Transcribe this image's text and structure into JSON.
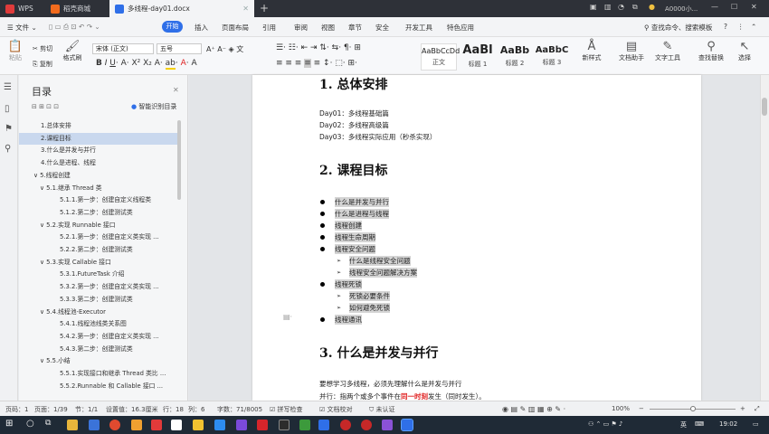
{
  "titlebar": {
    "tabs": [
      {
        "label": "WPS",
        "active": false
      },
      {
        "label": "稻壳商城",
        "active": false
      },
      {
        "label": "多线程-day01.docx",
        "active": true
      }
    ],
    "user": "A0000小..."
  },
  "menubar": {
    "file_label": "文件",
    "start_label": "开始",
    "items": [
      "插入",
      "页面布局",
      "引用",
      "审阅",
      "视图",
      "章节",
      "安全",
      "开发工具",
      "特色应用"
    ],
    "search_label": "查找命令、搜索模板"
  },
  "ribbon": {
    "cut": "剪切",
    "copy": "复制",
    "paste": "粘贴",
    "format_painter": "格式刷",
    "font_name": "宋体 (正文)",
    "font_size": "五号",
    "styles": [
      {
        "preview": "AaBbCcDd",
        "label": "正文"
      },
      {
        "preview": "AaBl",
        "label": "标题 1"
      },
      {
        "preview": "AaBb",
        "label": "标题 2"
      },
      {
        "preview": "AaBbC",
        "label": "标题 3"
      }
    ],
    "new_style": "新样式",
    "doc_helper": "文档助手",
    "text_tools": "文字工具",
    "find_replace": "查找替换",
    "select": "选择"
  },
  "toc": {
    "title": "目录",
    "smart": "智能识别目录",
    "items": [
      {
        "label": "1.总体安排",
        "indent": 0,
        "selected": false,
        "arrow": ""
      },
      {
        "label": "2.课程目标",
        "indent": 0,
        "selected": true,
        "arrow": ""
      },
      {
        "label": "3.什么是并发与并行",
        "indent": 0,
        "selected": false,
        "arrow": ""
      },
      {
        "label": "4.什么是进程、线程",
        "indent": 0,
        "selected": false,
        "arrow": ""
      },
      {
        "label": "5.线程创建",
        "indent": 0,
        "selected": false,
        "arrow": "∨"
      },
      {
        "label": "5.1.继承 Thread 类",
        "indent": 1,
        "selected": false,
        "arrow": "∨"
      },
      {
        "label": "5.1.1.第一步：创建自定义线程类",
        "indent": 2,
        "selected": false,
        "arrow": ""
      },
      {
        "label": "5.1.2.第二步：创建测试类",
        "indent": 2,
        "selected": false,
        "arrow": ""
      },
      {
        "label": "5.2.实现 Runnable 接口",
        "indent": 1,
        "selected": false,
        "arrow": "∨"
      },
      {
        "label": "5.2.1.第一步：创建自定义类实现 ...",
        "indent": 2,
        "selected": false,
        "arrow": ""
      },
      {
        "label": "5.2.2.第二步：创建测试类",
        "indent": 2,
        "selected": false,
        "arrow": ""
      },
      {
        "label": "5.3.实现 Callable 接口",
        "indent": 1,
        "selected": false,
        "arrow": "∨"
      },
      {
        "label": "5.3.1.FutureTask 介绍",
        "indent": 2,
        "selected": false,
        "arrow": ""
      },
      {
        "label": "5.3.2.第一步：创建自定义类实现 ...",
        "indent": 2,
        "selected": false,
        "arrow": ""
      },
      {
        "label": "5.3.3.第二步：创建测试类",
        "indent": 2,
        "selected": false,
        "arrow": ""
      },
      {
        "label": "5.4.线程池-Executor",
        "indent": 1,
        "selected": false,
        "arrow": "∨"
      },
      {
        "label": "5.4.1.线程池线类关系图",
        "indent": 2,
        "selected": false,
        "arrow": ""
      },
      {
        "label": "5.4.2.第一步：创建自定义类实现 ...",
        "indent": 2,
        "selected": false,
        "arrow": ""
      },
      {
        "label": "5.4.3.第二步：创建测试类",
        "indent": 2,
        "selected": false,
        "arrow": ""
      },
      {
        "label": "5.5.小结",
        "indent": 1,
        "selected": false,
        "arrow": "∨"
      },
      {
        "label": "5.5.1.实现接口和继承 Thread 类比 ...",
        "indent": 2,
        "selected": false,
        "arrow": ""
      },
      {
        "label": "5.5.2.Runnable 和 Callable 接口 ...",
        "indent": 2,
        "selected": false,
        "arrow": ""
      }
    ]
  },
  "doc": {
    "h1": "1. 总体安排",
    "days": [
      "Day01：多线程基础篇",
      "Day02：多线程高级篇",
      "Day03：多线程实际应用（秒杀实现）"
    ],
    "h2": "2. 课程目标",
    "bullets": [
      {
        "text": "什么是并发与并行",
        "level": 0
      },
      {
        "text": "什么是进程与线程",
        "level": 0
      },
      {
        "text": "线程创建",
        "level": 0
      },
      {
        "text": "线程生命周期",
        "level": 0
      },
      {
        "text": "线程安全问题",
        "level": 0
      },
      {
        "text": "什么是线程安全问题",
        "level": 1
      },
      {
        "text": "线程安全问题解决方案",
        "level": 1
      },
      {
        "text": "线程死锁",
        "level": 0
      },
      {
        "text": "死锁必要条件",
        "level": 1
      },
      {
        "text": "如何避免死锁",
        "level": 1
      },
      {
        "text": "线程通讯",
        "level": 0
      }
    ],
    "h3": "3. 什么是并发与并行",
    "p1": "要想学习多线程，必须先理解什么是并发与并行",
    "p2_before": "并行：指两个或多个事件在",
    "p2_red": "同一时刻",
    "p2_after": "发生（同时发生）。"
  },
  "status": {
    "page_num": "页码：1",
    "pages": "页面：1/39",
    "section": "节：1/1",
    "setting": "设置值：16.3厘米",
    "row": "行：18",
    "col": "列：6",
    "words": "字数：71/8005",
    "spell": "拼写检查",
    "proof": "文档校对",
    "cert": "未认证",
    "zoom": "100%"
  },
  "taskbar": {
    "time": "19:02",
    "ime": "英"
  }
}
